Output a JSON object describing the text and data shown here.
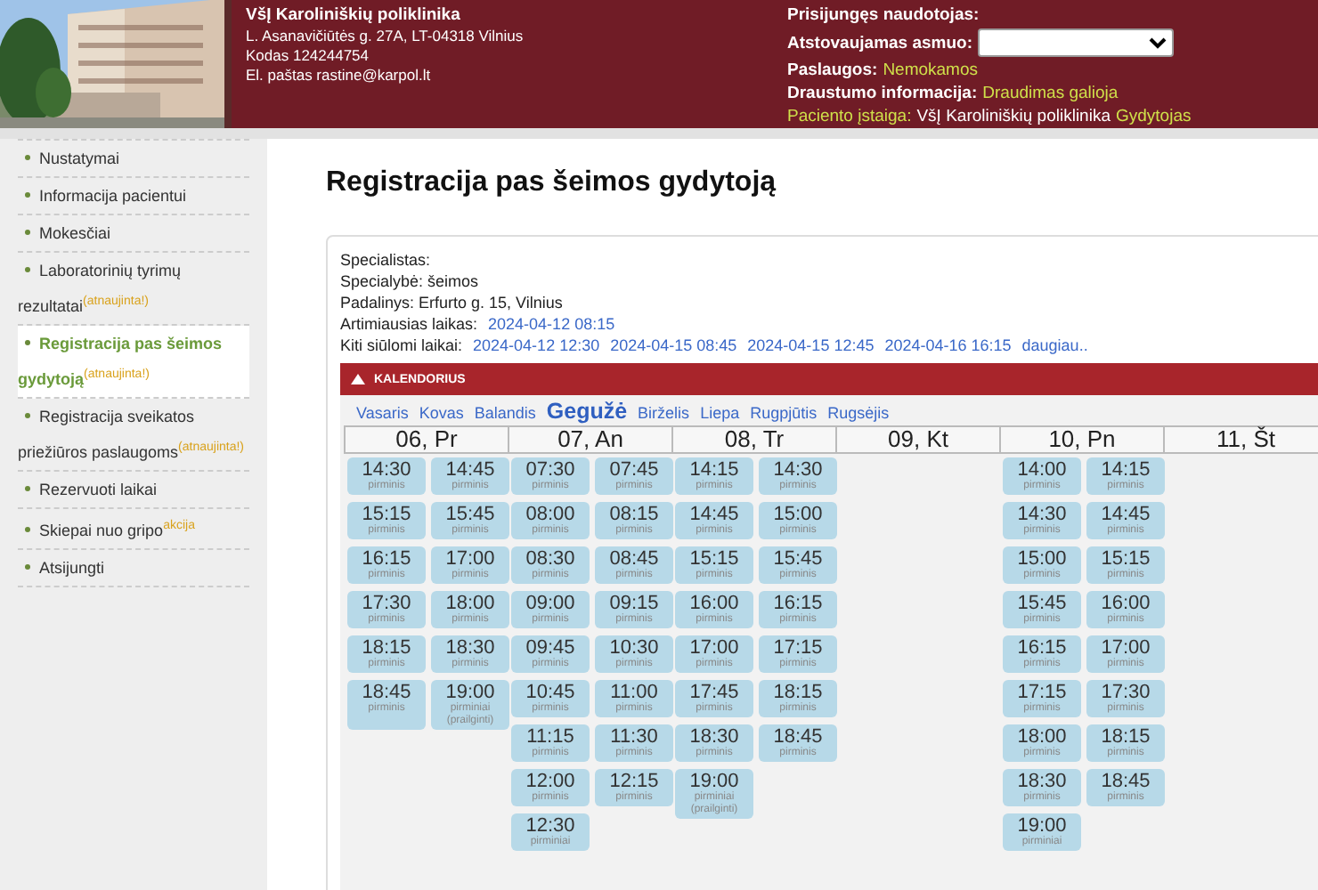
{
  "header": {
    "clinic_name": "VšĮ Karoliniškių poliklinika",
    "address": "L. Asanavičiūtės g. 27A, LT-04318 Vilnius",
    "code": "Kodas 124244754",
    "email": "El. paštas rastine@karpol.lt",
    "user_label": "Prisijungęs naudotojas:",
    "person_label": "Atstovaujamas asmuo:",
    "services_label": "Paslaugos:",
    "services_value": "Nemokamos",
    "insurance_label": "Draustumo informacija:",
    "insurance_value": "Draudimas galioja",
    "institution_label": "Paciento įstaiga:",
    "institution_value": "VšĮ Karoliniškių poliklinika",
    "institution_role": "Gydytojas"
  },
  "sidebar": {
    "items": [
      {
        "label": "Nustatymai",
        "selected": false
      },
      {
        "label": "Informacija pacientui",
        "selected": false
      },
      {
        "label": "Mokesčiai",
        "selected": false
      },
      {
        "label": "Laboratorinių tyrimų rezultatai",
        "badge": "(atnaujinta!)",
        "selected": false
      },
      {
        "label": "Registracija pas šeimos gydytoją",
        "badge": "(atnaujinta!)",
        "selected": true
      },
      {
        "label": "Registracija sveikatos priežiūros paslaugoms",
        "badge": "(atnaujinta!)",
        "selected": false
      },
      {
        "label": "Rezervuoti laikai",
        "selected": false
      },
      {
        "label": "Skiepai nuo gripo",
        "badge": "akcija",
        "selected": false
      },
      {
        "label": "Atsijungti",
        "selected": false
      }
    ]
  },
  "page_title": "Registracija pas šeimos gydytoją",
  "info": {
    "specialist": "Specialistas:",
    "specialty": "Specialybė: šeimos",
    "department": "Padalinys: Erfurto g. 15, Vilnius",
    "nearest_label": "Artimiausias laikas:",
    "nearest_time": "2024-04-12 08:15",
    "other_label": "Kiti siūlomi laikai:",
    "other_times": [
      "2024-04-12 12:30",
      "2024-04-15 08:45",
      "2024-04-15 12:45",
      "2024-04-16 16:15"
    ],
    "more_link": "daugiau.."
  },
  "calendar": {
    "title": "KALENDORIUS",
    "expanded": true,
    "months": [
      {
        "label": "Vasaris",
        "selected": false
      },
      {
        "label": "Kovas",
        "selected": false
      },
      {
        "label": "Balandis",
        "selected": false
      },
      {
        "label": "Gegužė",
        "selected": true
      },
      {
        "label": "Birželis",
        "selected": false
      },
      {
        "label": "Liepa",
        "selected": false
      },
      {
        "label": "Rugpjūtis",
        "selected": false
      },
      {
        "label": "Rugsėjis",
        "selected": false
      }
    ],
    "days": [
      {
        "label": "06, Pr",
        "slots": [
          {
            "time": "14:30",
            "type": "pirminis"
          },
          {
            "time": "14:45",
            "type": "pirminis"
          },
          {
            "time": "15:15",
            "type": "pirminis"
          },
          {
            "time": "15:45",
            "type": "pirminis"
          },
          {
            "time": "16:15",
            "type": "pirminis"
          },
          {
            "time": "17:00",
            "type": "pirminis"
          },
          {
            "time": "17:30",
            "type": "pirminis"
          },
          {
            "time": "18:00",
            "type": "pirminis"
          },
          {
            "time": "18:15",
            "type": "pirminis"
          },
          {
            "time": "18:30",
            "type": "pirminis"
          },
          {
            "time": "18:45",
            "type": "pirminis"
          },
          {
            "time": "19:00",
            "type": "pirminiai (prailginti)"
          }
        ]
      },
      {
        "label": "07, An",
        "slots": [
          {
            "time": "07:30",
            "type": "pirminis"
          },
          {
            "time": "07:45",
            "type": "pirminis"
          },
          {
            "time": "08:00",
            "type": "pirminis"
          },
          {
            "time": "08:15",
            "type": "pirminis"
          },
          {
            "time": "08:30",
            "type": "pirminis"
          },
          {
            "time": "08:45",
            "type": "pirminis"
          },
          {
            "time": "09:00",
            "type": "pirminis"
          },
          {
            "time": "09:15",
            "type": "pirminis"
          },
          {
            "time": "09:45",
            "type": "pirminis"
          },
          {
            "time": "10:30",
            "type": "pirminis"
          },
          {
            "time": "10:45",
            "type": "pirminis"
          },
          {
            "time": "11:00",
            "type": "pirminis"
          },
          {
            "time": "11:15",
            "type": "pirminis"
          },
          {
            "time": "11:30",
            "type": "pirminis"
          },
          {
            "time": "12:00",
            "type": "pirminis"
          },
          {
            "time": "12:15",
            "type": "pirminis"
          },
          {
            "time": "12:30",
            "type": "pirminiai"
          }
        ]
      },
      {
        "label": "08, Tr",
        "slots": [
          {
            "time": "14:15",
            "type": "pirminis"
          },
          {
            "time": "14:30",
            "type": "pirminis"
          },
          {
            "time": "14:45",
            "type": "pirminis"
          },
          {
            "time": "15:00",
            "type": "pirminis"
          },
          {
            "time": "15:15",
            "type": "pirminis"
          },
          {
            "time": "15:45",
            "type": "pirminis"
          },
          {
            "time": "16:00",
            "type": "pirminis"
          },
          {
            "time": "16:15",
            "type": "pirminis"
          },
          {
            "time": "17:00",
            "type": "pirminis"
          },
          {
            "time": "17:15",
            "type": "pirminis"
          },
          {
            "time": "17:45",
            "type": "pirminis"
          },
          {
            "time": "18:15",
            "type": "pirminis"
          },
          {
            "time": "18:30",
            "type": "pirminis"
          },
          {
            "time": "18:45",
            "type": "pirminis"
          },
          {
            "time": "19:00",
            "type": "pirminiai (prailginti)"
          }
        ]
      },
      {
        "label": "09, Kt"
      },
      {
        "label": "10, Pn",
        "slots": [
          {
            "time": "14:00",
            "type": "pirminis"
          },
          {
            "time": "14:15",
            "type": "pirminis"
          },
          {
            "time": "14:30",
            "type": "pirminis"
          },
          {
            "time": "14:45",
            "type": "pirminis"
          },
          {
            "time": "15:00",
            "type": "pirminis"
          },
          {
            "time": "15:15",
            "type": "pirminis"
          },
          {
            "time": "15:45",
            "type": "pirminis"
          },
          {
            "time": "16:00",
            "type": "pirminis"
          },
          {
            "time": "16:15",
            "type": "pirminis"
          },
          {
            "time": "17:00",
            "type": "pirminis"
          },
          {
            "time": "17:15",
            "type": "pirminis"
          },
          {
            "time": "17:30",
            "type": "pirminis"
          },
          {
            "time": "18:00",
            "type": "pirminis"
          },
          {
            "time": "18:15",
            "type": "pirminis"
          },
          {
            "time": "18:30",
            "type": "pirminis"
          },
          {
            "time": "18:45",
            "type": "pirminis"
          },
          {
            "time": "19:00",
            "type": "pirminiai"
          }
        ]
      },
      {
        "label": "11, Št"
      }
    ]
  }
}
